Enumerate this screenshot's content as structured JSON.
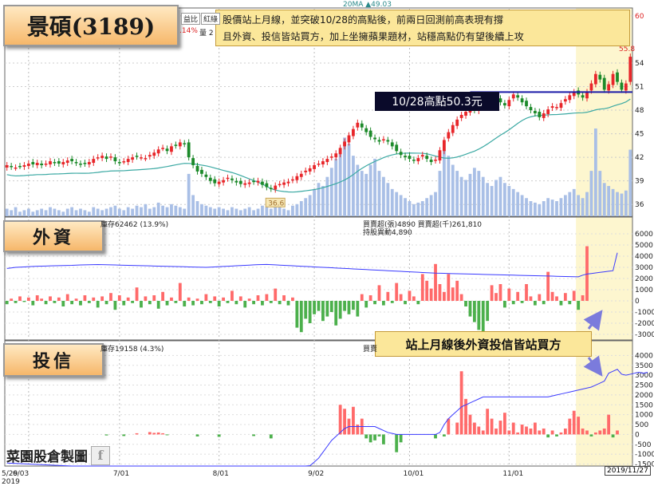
{
  "titles": {
    "stock": "景碩(3189)",
    "foreign": "外資",
    "trust": "投信",
    "watermark": "菜園股倉製圖",
    "watermark_icon": "facebook-f-icon"
  },
  "note": {
    "line1": "股價站上月線，並突破10/28的高點後，前兩日回測前高表現有撐",
    "line2": "且外資、投信皆站買方，加上坐擁蘋果題材，站穩高點仍有望後續上攻"
  },
  "callouts": {
    "high": "10/28高點50.3元",
    "buy": "站上月線後外資投信皆站買方"
  },
  "top_toolbar": {
    "partial_labels": [
      "益比",
      "紅綠"
    ],
    "change_partial": ".14%",
    "volume_partial": "量 2",
    "ma_legend": "20MA ▲49.03"
  },
  "foreign_panel": {
    "holdings": "庫存62462 (13.9%)",
    "legend_buy": "買賣超(張)4890 買賣超(千)261,810",
    "legend_hold": "持股異動4,890"
  },
  "trust_panel": {
    "holdings": "庫存19158 (4.3%)",
    "legend_buy": "買賣"
  },
  "date_box": "2019/11/27",
  "colors": {
    "up": "#e8262a",
    "down": "#1c8a2a",
    "volume": "#a9bfe6",
    "ma": "#3ba9a3",
    "holding_line": "#3a3aff",
    "bar_up": "#ff6a6a",
    "bar_down": "#4cb04c",
    "highlight": "#fdf6cf",
    "resistance": "#1a1aa8"
  },
  "chart_data": [
    {
      "type": "candlestick",
      "title": "景碩(3189)",
      "x_ticks": [
        "5/29",
        "6/03",
        "7/01",
        "8/01",
        "9/02",
        "10/01",
        "11/01"
      ],
      "x_year": "2019",
      "y_ticks": [
        36,
        39,
        42,
        45,
        48,
        51,
        54,
        60
      ],
      "ylim": [
        34.5,
        61
      ],
      "resistance": {
        "label": "10/28高點50.3元",
        "value": 50.3
      },
      "annotations": [
        {
          "text": "36.6",
          "value": 36.6
        },
        {
          "text": "55.8",
          "value": 55.8
        }
      ],
      "close": [
        41.0,
        40.8,
        40.7,
        40.9,
        41.0,
        41.2,
        41.1,
        41.3,
        41.0,
        41.2,
        41.5,
        41.3,
        41.2,
        41.4,
        41.6,
        41.5,
        41.3,
        41.1,
        41.2,
        41.4,
        41.8,
        42.0,
        42.2,
        41.8,
        42.1,
        41.5,
        41.3,
        41.5,
        41.8,
        42.0,
        42.1,
        42.0,
        41.9,
        42.3,
        42.6,
        43.0,
        43.2,
        42.8,
        43.4,
        43.5,
        43.9,
        43.7,
        42.0,
        41.0,
        40.2,
        39.9,
        39.5,
        39.0,
        38.7,
        38.9,
        39.1,
        39.4,
        39.1,
        38.8,
        38.6,
        38.7,
        38.8,
        38.9,
        39.0,
        38.5,
        38.2,
        38.0,
        38.4,
        38.6,
        38.8,
        38.9,
        39.2,
        39.6,
        39.9,
        40.3,
        40.6,
        41.0,
        41.2,
        41.5,
        41.8,
        42.1,
        42.5,
        43.2,
        44.0,
        44.8,
        45.6,
        46.4,
        45.8,
        45.2,
        44.6,
        44.3,
        44.0,
        44.3,
        44.0,
        43.4,
        42.8,
        42.3,
        42.0,
        41.8,
        41.6,
        41.9,
        42.3,
        41.8,
        41.4,
        41.7,
        42.9,
        44.2,
        45.2,
        46.1,
        46.8,
        47.4,
        47.8,
        48.3,
        48.0,
        48.6,
        48.9,
        49.2,
        49.5,
        49.3,
        49.0,
        48.6,
        49.3,
        50.0,
        49.6,
        49.0,
        48.5,
        48.0,
        47.6,
        47.1,
        47.6,
        48.1,
        48.5,
        48.4,
        48.9,
        49.4,
        49.9,
        50.3,
        50.0,
        49.6,
        50.3,
        51.4,
        52.6,
        51.9,
        50.6,
        51.3,
        52.6,
        51.6,
        50.6,
        51.4,
        54.8
      ],
      "volume": [
        5,
        4,
        6,
        3,
        4,
        5,
        3,
        4,
        5,
        4,
        6,
        5,
        4,
        3,
        5,
        6,
        4,
        5,
        4,
        3,
        6,
        5,
        4,
        5,
        6,
        7,
        5,
        4,
        6,
        5,
        7,
        6,
        8,
        5,
        6,
        9,
        7,
        6,
        8,
        7,
        6,
        5,
        28,
        14,
        10,
        8,
        7,
        6,
        5,
        6,
        5,
        4,
        6,
        5,
        4,
        5,
        6,
        4,
        5,
        7,
        6,
        5,
        8,
        6,
        5,
        4,
        7,
        8,
        10,
        12,
        14,
        18,
        22,
        20,
        26,
        32,
        38,
        44,
        52,
        48,
        40,
        34,
        30,
        28,
        34,
        38,
        30,
        26,
        22,
        18,
        16,
        14,
        12,
        10,
        8,
        9,
        10,
        12,
        14,
        16,
        30,
        44,
        40,
        34,
        30,
        26,
        24,
        28,
        32,
        30,
        26,
        22,
        20,
        24,
        26,
        22,
        20,
        18,
        16,
        14,
        12,
        10,
        9,
        8,
        10,
        12,
        11,
        10,
        12,
        14,
        16,
        18,
        14,
        12,
        16,
        30,
        58,
        30,
        22,
        20,
        18,
        16,
        15,
        17,
        44
      ]
    },
    {
      "type": "bar",
      "title": "外資",
      "y_ticks": [
        -3000,
        -2000,
        -1000,
        0,
        1000,
        2000,
        3000,
        4000,
        5000,
        6000
      ],
      "ylim": [
        -3500,
        6500
      ],
      "holdings_line": [
        2900,
        2950,
        3000,
        3020,
        3040,
        3060,
        3080,
        3100,
        3110,
        3120,
        3130,
        3140,
        3150,
        3160,
        3170,
        3180,
        3200,
        3210,
        3220,
        3230,
        3240,
        3250,
        3240,
        3230,
        3220,
        3210,
        3200,
        3190,
        3180,
        3170,
        3160,
        3150,
        3140,
        3130,
        3120,
        3110,
        3100,
        3090,
        3080,
        3070,
        3060,
        3050,
        3040,
        3030,
        3020,
        3010,
        3000,
        3020,
        3040,
        3060,
        3080,
        3100,
        3120,
        3140,
        3160,
        3180,
        3200,
        3220,
        3240,
        3250,
        3260,
        3240,
        3220,
        3200,
        3180,
        3160,
        3140,
        3120,
        3100,
        3080,
        3060,
        3040,
        3020,
        3000,
        2980,
        2960,
        2940,
        2920,
        2900,
        2880,
        2860,
        2840,
        2820,
        2800,
        2780,
        2760,
        2740,
        2720,
        2700,
        2680,
        2660,
        2640,
        2620,
        2600,
        2580,
        2560,
        2540,
        2520,
        2500,
        2480,
        2470,
        2460,
        2450,
        2440,
        2430,
        2420,
        2410,
        2400,
        2390,
        2380,
        2370,
        2360,
        2350,
        2340,
        2330,
        2320,
        2310,
        2300,
        2290,
        2280,
        2270,
        2260,
        2250,
        2240,
        2230,
        2220,
        2210,
        2200,
        2190,
        2180,
        2170,
        2160,
        2150,
        2300,
        2400,
        2450,
        2500,
        2550,
        2600,
        2650,
        2700,
        4300
      ],
      "values": [
        -300,
        200,
        -200,
        400,
        -100,
        300,
        -400,
        500,
        200,
        -300,
        400,
        -200,
        300,
        -500,
        600,
        -300,
        200,
        -400,
        500,
        -200,
        300,
        -600,
        400,
        -300,
        700,
        -800,
        500,
        -400,
        300,
        -200,
        1200,
        -600,
        400,
        -300,
        500,
        -700,
        800,
        -400,
        300,
        -200,
        1600,
        -500,
        300,
        -400,
        200,
        -300,
        600,
        -200,
        400,
        -500,
        300,
        -200,
        900,
        -300,
        400,
        -600,
        200,
        -300,
        500,
        -400,
        600,
        -200,
        1100,
        -300,
        500,
        -400,
        300,
        -2400,
        -2800,
        -1600,
        -2000,
        -1200,
        -900,
        -1800,
        -1400,
        -1000,
        -2200,
        -1600,
        -900,
        -1200,
        -800,
        -1400,
        600,
        -600,
        500,
        -300,
        1400,
        -400,
        800,
        -200,
        1600,
        600,
        -300,
        900,
        400,
        -300,
        2400,
        1800,
        1100,
        3300,
        1500,
        800,
        2400,
        1200,
        1800,
        600,
        -500,
        -1400,
        -1900,
        -2600,
        -2800,
        -1800,
        1400,
        700,
        1500,
        -600,
        1100,
        -300,
        800,
        -200,
        1500,
        400,
        -400,
        600,
        -300,
        2600,
        800,
        400,
        -400,
        700,
        -300,
        900,
        -800,
        500,
        4890
      ]
    },
    {
      "type": "bar",
      "title": "投信",
      "y_ticks": [
        -1500,
        -1000,
        -500,
        0,
        500,
        1000,
        1500,
        2000,
        2500,
        3000,
        3500,
        4000
      ],
      "ylim": [
        -1600,
        4300
      ],
      "holdings_line": [
        -1450,
        -1460,
        -1470,
        -1480,
        -1490,
        -1500,
        -1510,
        -1520,
        -1530,
        -1540,
        -1550,
        -1560,
        -1570,
        -1580,
        -1590,
        -1600,
        -1600,
        -1600,
        -1600,
        -1600,
        -1600,
        -1600,
        -1600,
        -1600,
        -1600,
        -1600,
        -1600,
        -1600,
        -1600,
        -1600,
        -1600,
        -1600,
        -1600,
        -1600,
        -1600,
        -1600,
        -1600,
        -1600,
        -1600,
        -1600,
        -1600,
        -1600,
        -1600,
        -1600,
        -1600,
        -1600,
        -1600,
        -1600,
        -1600,
        -1600,
        -1600,
        -1600,
        -1600,
        -1600,
        -1600,
        -1600,
        -1600,
        -1600,
        -1600,
        -1600,
        -1600,
        -1600,
        -1600,
        -1600,
        -1600,
        -1600,
        -1600,
        -1600,
        -1600,
        -1600,
        -1580,
        -1400,
        -1200,
        -900,
        -600,
        -300,
        -100,
        100,
        300,
        400,
        400,
        400,
        400,
        400,
        400,
        400,
        300,
        200,
        100,
        50,
        0,
        0,
        0,
        0,
        0,
        0,
        0,
        0,
        0,
        0,
        100,
        500,
        800,
        1000,
        1200,
        1400,
        1500,
        1600,
        1700,
        1800,
        1900,
        1900,
        1900,
        1900,
        1900,
        1900,
        1900,
        1900,
        1900,
        1900,
        1900,
        1900,
        1900,
        1900,
        1900,
        1900,
        1950,
        2000,
        2050,
        2100,
        2150,
        2200,
        2250,
        2300,
        2350,
        2400,
        2500,
        2600,
        2700,
        3100,
        3200,
        3300,
        3050,
        3000,
        3050,
        3100,
        3150,
        3100,
        3150
      ],
      "values": [
        0,
        0,
        0,
        0,
        0,
        0,
        0,
        0,
        0,
        0,
        0,
        0,
        0,
        0,
        0,
        0,
        0,
        0,
        0,
        0,
        0,
        0,
        0,
        -50,
        0,
        0,
        0,
        -80,
        0,
        0,
        60,
        0,
        0,
        120,
        80,
        100,
        60,
        -40,
        0,
        0,
        0,
        0,
        0,
        0,
        -100,
        0,
        0,
        0,
        0,
        -120,
        0,
        0,
        0,
        0,
        0,
        0,
        0,
        -80,
        0,
        0,
        0,
        -200,
        0,
        0,
        0,
        0,
        0,
        0,
        0,
        0,
        0,
        0,
        0,
        0,
        0,
        0,
        0,
        1500,
        1300,
        800,
        1400,
        500,
        800,
        -200,
        -400,
        -300,
        -100,
        -500,
        0,
        0,
        -900,
        -400,
        0,
        0,
        0,
        0,
        0,
        0,
        0,
        -200,
        0,
        -100,
        800,
        0,
        600,
        3200,
        1800,
        1000,
        600,
        400,
        200,
        1300,
        800,
        300,
        700,
        1100,
        200,
        600,
        100,
        500,
        400,
        300,
        600,
        200,
        300,
        -150,
        200,
        -100,
        100,
        300,
        800,
        1200,
        900,
        300,
        200,
        -100,
        100,
        200,
        300,
        1000,
        -150,
        200
      ]
    }
  ]
}
